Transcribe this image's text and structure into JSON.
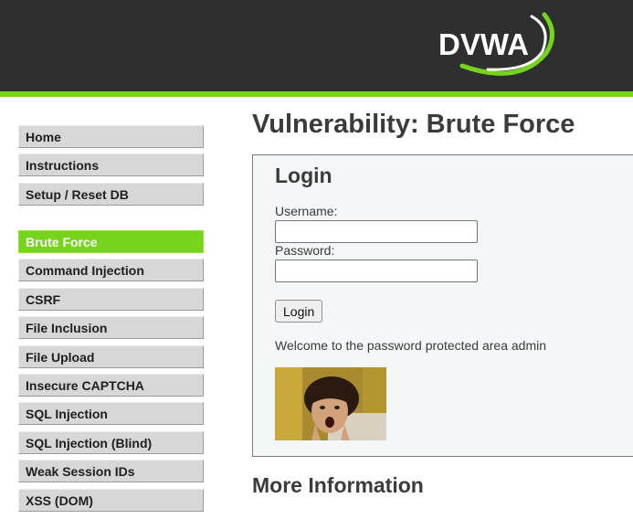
{
  "header": {
    "logo_text": "DVWA",
    "accent_color": "#76d41c",
    "background_color": "#2f2f2f"
  },
  "menu": {
    "groups": [
      [
        "Home",
        "Instructions",
        "Setup / Reset DB"
      ],
      [
        "Brute Force",
        "Command Injection",
        "CSRF",
        "File Inclusion",
        "File Upload",
        "Insecure CAPTCHA",
        "SQL Injection",
        "SQL Injection (Blind)",
        "Weak Session IDs",
        "XSS (DOM)"
      ]
    ],
    "selected": "Brute Force"
  },
  "main": {
    "page_title": "Vulnerability: Brute Force",
    "login": {
      "title": "Login",
      "username_label": "Username:",
      "username_value": "",
      "password_label": "Password:",
      "password_value": "",
      "button_label": "Login"
    },
    "welcome_message": "Welcome to the password protected area admin",
    "more_info_heading": "More Information"
  }
}
